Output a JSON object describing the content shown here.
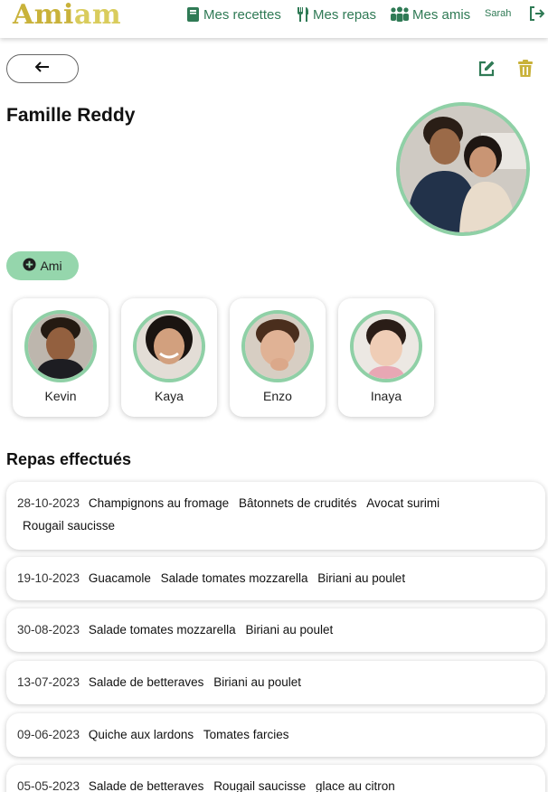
{
  "header": {
    "logo_part1": "Ami",
    "logo_part2": "am",
    "nav_recipes": "Mes recettes",
    "nav_meals": "Mes repas",
    "nav_friends": "Mes amis",
    "user": "Sarah",
    "icons": [
      "book-icon",
      "utensils-icon",
      "users-icon",
      "logout-icon"
    ]
  },
  "toolbar": {
    "icons": [
      "arrow-left-icon",
      "edit-icon",
      "trash-icon"
    ]
  },
  "family": {
    "title": "Famille Reddy"
  },
  "add_friend_label": "Ami",
  "members": [
    {
      "name": "Kevin"
    },
    {
      "name": "Kaya"
    },
    {
      "name": "Enzo"
    },
    {
      "name": "Inaya"
    }
  ],
  "meals_title": "Repas effectués",
  "meals": [
    {
      "date": "28-10-2023",
      "dishes": [
        "Champignons au fromage",
        "Bâtonnets de crudités",
        "Avocat surimi"
      ],
      "dishes_line2": [
        "Rougail saucisse"
      ]
    },
    {
      "date": "19-10-2023",
      "dishes": [
        "Guacamole",
        "Salade tomates mozzarella",
        "Biriani au poulet"
      ]
    },
    {
      "date": "30-08-2023",
      "dishes": [
        "Salade tomates mozzarella",
        "Biriani au poulet"
      ]
    },
    {
      "date": "13-07-2023",
      "dishes": [
        "Salade de betteraves",
        "Biriani au poulet"
      ]
    },
    {
      "date": "09-06-2023",
      "dishes": [
        "Quiche aux lardons",
        "Tomates farcies"
      ]
    },
    {
      "date": "05-05-2023",
      "dishes": [
        "Salade de betteraves",
        "Rougail saucisse",
        "glace au citron"
      ]
    }
  ],
  "colors": {
    "accent_green": "#2f7a55",
    "light_green": "#95d6ac",
    "ring_green": "#8fd0a6",
    "logo_gold": "#c9b23a"
  }
}
